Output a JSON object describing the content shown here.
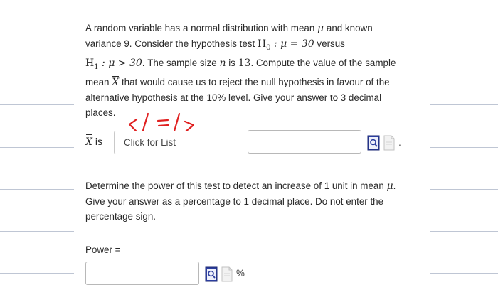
{
  "question1": {
    "line1_a": "A random variable has a normal distribution with mean",
    "line1_mu": "μ",
    "line1_b": "and known",
    "line2_a": "variance 9. Consider the hypothesis test",
    "line2_H0": "H",
    "line2_H0sub": "0",
    "line2_math": ": μ = 30",
    "line2_b": "versus",
    "line3_H1": "H",
    "line3_H1sub": "1",
    "line3_math": ": μ > 30",
    "line3_a": ". The sample size",
    "line3_n": "n",
    "line3_b": "is",
    "line3_13": "13",
    "line3_c": ". Compute the value of the sample",
    "line4_a": "mean",
    "line4_X": "X",
    "line4_b": "that would cause us to reject the null hypothesis in favour of the",
    "line5": "alternative hypothesis at the 10% level. Give your answer to 3 decimal",
    "line6": "places."
  },
  "handwriting_text": "</=/>",
  "answer_row": {
    "x_symbol": "X",
    "is_label": "is",
    "select_value": "Click for List",
    "input_value": "",
    "trailing_dot": "."
  },
  "question2": {
    "line1_a": "Determine the power of this test to detect an increase of 1 unit in mean",
    "line1_mu": "μ",
    "line1_b": ".",
    "line2": "Give your answer as a percentage to 1 decimal place. Do not enter the",
    "line3": "percentage sign."
  },
  "power": {
    "label": "Power =",
    "input_value": "",
    "unit": "%"
  },
  "colors": {
    "handwriting": "#e02020",
    "icon_blue": "#2b3d9e",
    "rule": "#bfc6d4"
  },
  "icons": [
    "magnifier-document-icon",
    "blank-document-icon"
  ]
}
